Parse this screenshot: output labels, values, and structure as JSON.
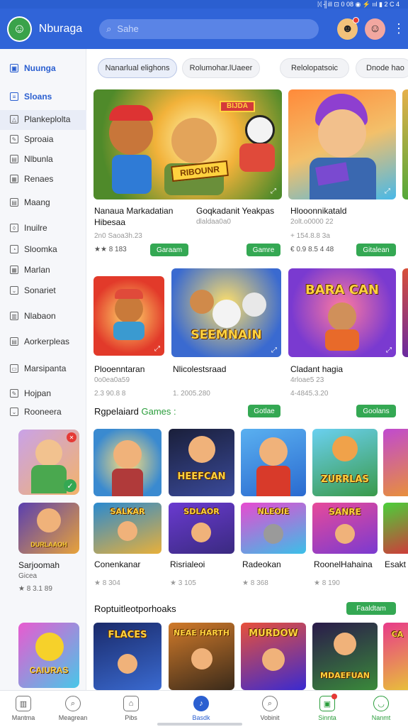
{
  "status": {
    "text": "ᛞ ╢ill ⊡ 0 08 ◉ ⚡ ııl ▮ 2 C 4"
  },
  "header": {
    "app_name": "Nburaga",
    "search_placeholder": "Sahe"
  },
  "sidebar": {
    "items": [
      {
        "label": "Nuunga"
      },
      {
        "label": "Sloans"
      },
      {
        "label": "Plankeplolta"
      },
      {
        "label": "Sproaia"
      },
      {
        "label": "Nlbunla"
      },
      {
        "label": "Renaes"
      },
      {
        "label": "Maang"
      },
      {
        "label": "Inuilre"
      },
      {
        "label": "Sloomka"
      },
      {
        "label": "Marlan"
      },
      {
        "label": "Sonariet"
      },
      {
        "label": "Nlabaon"
      },
      {
        "label": "Aorkerpleas"
      },
      {
        "label": "Marsipanta"
      },
      {
        "label": "Hojpan"
      },
      {
        "label": "Rooneera"
      }
    ],
    "card": {
      "title": "Sarjoomah",
      "sub": "Gicea",
      "meta": "★ 8 3.1 89"
    }
  },
  "chips": [
    {
      "label": "Nanarlual elighons"
    },
    {
      "label": "Rolumohar.lUaeer"
    },
    {
      "label": "Relolopatsoic"
    },
    {
      "label": "Dnode hao"
    }
  ],
  "row1": [
    {
      "title": "Nanaua Markadatian",
      "title2": "Hibesaa",
      "sub": "2n0 Saoa3h.23",
      "meta": "★★ 8 183",
      "button": "Garaam",
      "art": "BIJDA"
    },
    {
      "title": "Goqkadanit Yeakpas",
      "sub": "dlaldaa0a0",
      "meta": "",
      "button": "Gamre",
      "art": ""
    },
    {
      "title": "Hlooonnikatald",
      "sub": "2olt.o0000 22",
      "meta": "€ 0.9 8.5 4 48",
      "button": "Gitalean",
      "art": ""
    }
  ],
  "row1_sub2": "+ 154.8.8 3a",
  "row2": [
    {
      "title": "Plooenntaran",
      "sub": "0o0ea0a59",
      "meta": "2.3 90.8 8",
      "art": ""
    },
    {
      "title": "Nlicolestsraad",
      "sub": "",
      "meta": "1. 2005.280",
      "art": "SEEMNAIN"
    },
    {
      "title": "Cladant hagia",
      "sub": "4rloae5 23",
      "meta": "4-4845.3.20",
      "art": "BARA CAN"
    }
  ],
  "section1": {
    "title": "Rgpelaiard",
    "title_accent": "Games",
    "button": "Gotlae",
    "button2": "Goolans"
  },
  "row3": [
    {
      "art": ""
    },
    {
      "art": "HEEFCAN"
    },
    {
      "art": ""
    },
    {
      "art": "ZURRLAS"
    }
  ],
  "row4": [
    {
      "title": "Conenkanar",
      "meta": "★ 8 304",
      "art": "SALKAR"
    },
    {
      "title": "Risrialeoi",
      "meta": "★ 3 105",
      "art": "SDLAOR"
    },
    {
      "title": "Radeokan",
      "meta": "★ 8 368",
      "art": "NLEOIE"
    },
    {
      "title": "RoonelHahaina",
      "meta": "★ 8 190",
      "art": "SANRE"
    },
    {
      "title": "Esakt"
    }
  ],
  "section2": {
    "title": "Roptuitleotporhoaks",
    "button": "Faaldtam"
  },
  "row5": [
    {
      "art": "FLACES"
    },
    {
      "art": "NEAE HARTH"
    },
    {
      "art": "MURDOW"
    },
    {
      "art": "MDAEFUAN"
    },
    {
      "art": "CA"
    }
  ],
  "sidecard2_art": "CAIURAS",
  "nav": [
    {
      "label": "Mantma"
    },
    {
      "label": "Meagrean"
    },
    {
      "label": "Pibs"
    },
    {
      "label": "Basdk"
    },
    {
      "label": "Vobinit"
    },
    {
      "label": "Sinnta"
    },
    {
      "label": "Nanmt"
    }
  ]
}
